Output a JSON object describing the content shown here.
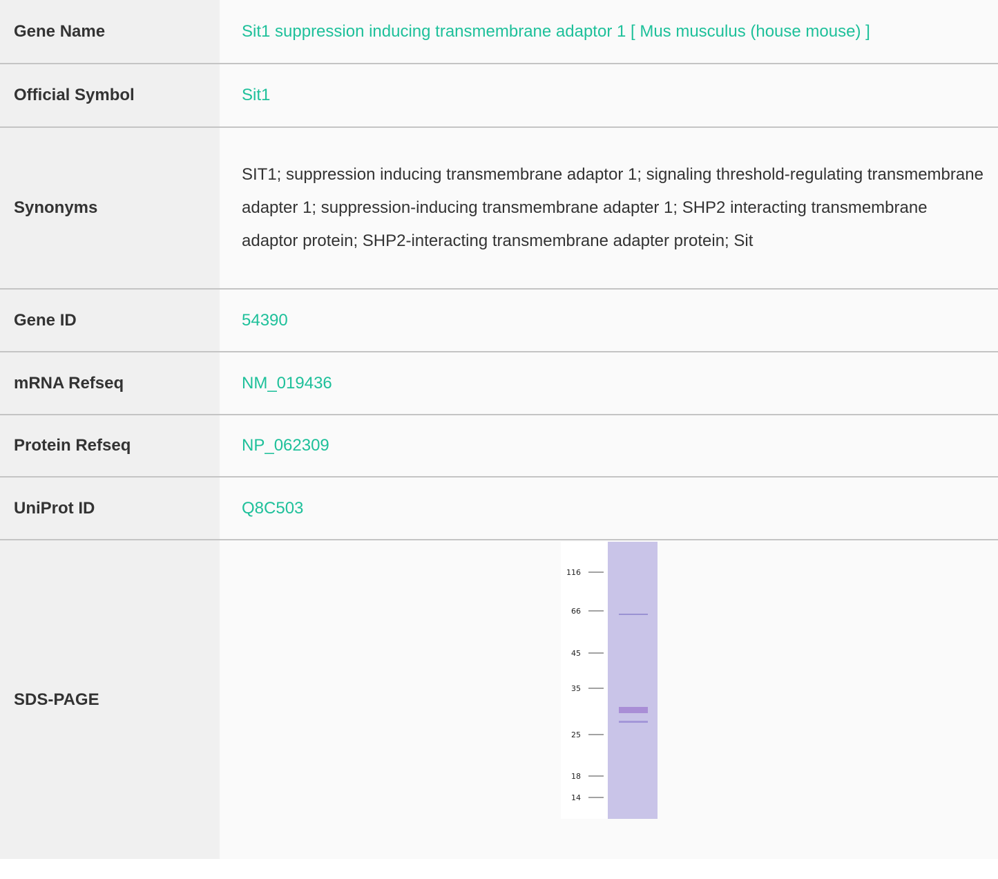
{
  "rows": [
    {
      "label": "Gene Name",
      "value": "Sit1 suppression inducing transmembrane adaptor 1 [ Mus musculus (house mouse) ]"
    },
    {
      "label": "Official Symbol",
      "value": "Sit1"
    },
    {
      "label": "Synonyms",
      "value": "SIT1; suppression inducing transmembrane adaptor 1; signaling threshold-regulating transmembrane adapter 1; suppression-inducing transmembrane adapter 1; SHP2 interacting transmembrane adaptor protein; SHP2-interacting transmembrane adapter protein; Sit"
    },
    {
      "label": "Gene ID",
      "value": "54390"
    },
    {
      "label": "mRNA Refseq",
      "value": "NM_019436"
    },
    {
      "label": "Protein Refseq",
      "value": "NP_062309"
    },
    {
      "label": "UniProt ID",
      "value": "Q8C503"
    },
    {
      "label": "SDS-PAGE"
    }
  ],
  "gel": {
    "markers": [
      "116",
      "66",
      "45",
      "35",
      "25",
      "18",
      "14"
    ]
  },
  "colors": {
    "link": "#1ec09a",
    "label_bg": "#f0f0f0",
    "value_bg": "#fafafa",
    "lane": "#c9c4e8",
    "band": "#a98ed6"
  }
}
